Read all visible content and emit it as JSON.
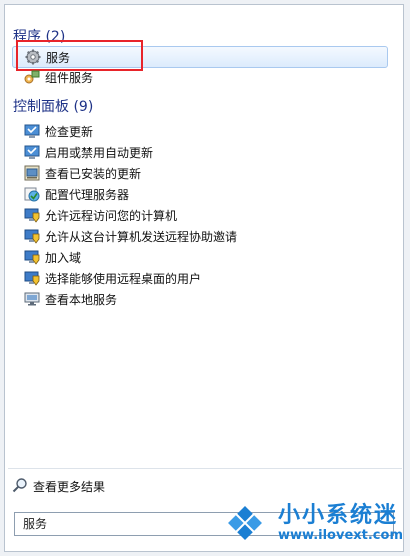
{
  "programs": {
    "title": "程序 (2)",
    "items": [
      {
        "label": "服务",
        "icon": "gear-icon"
      },
      {
        "label": "组件服务",
        "icon": "component-services-icon"
      }
    ]
  },
  "control_panel": {
    "title": "控制面板 (9)",
    "items": [
      {
        "label": "检查更新",
        "icon": "windows-update-icon"
      },
      {
        "label": "启用或禁用自动更新",
        "icon": "windows-update-icon"
      },
      {
        "label": "查看已安装的更新",
        "icon": "installed-updates-icon"
      },
      {
        "label": "配置代理服务器",
        "icon": "internet-options-icon"
      },
      {
        "label": "允许远程访问您的计算机",
        "icon": "system-shield-icon"
      },
      {
        "label": "允许从这台计算机发送远程协助邀请",
        "icon": "system-shield-icon"
      },
      {
        "label": "加入域",
        "icon": "system-shield-icon"
      },
      {
        "label": "选择能够使用远程桌面的用户",
        "icon": "system-shield-icon"
      },
      {
        "label": "查看本地服务",
        "icon": "monitor-icon"
      }
    ]
  },
  "more_results": {
    "label": "查看更多结果",
    "icon": "search-icon"
  },
  "search": {
    "value": "服务"
  },
  "watermark": {
    "name": "小小系统迷",
    "url": "www.ilovext.com"
  },
  "colors": {
    "heading": "#1e3287",
    "highlight": "#e8242a",
    "watermark": "#1b7fd3"
  }
}
